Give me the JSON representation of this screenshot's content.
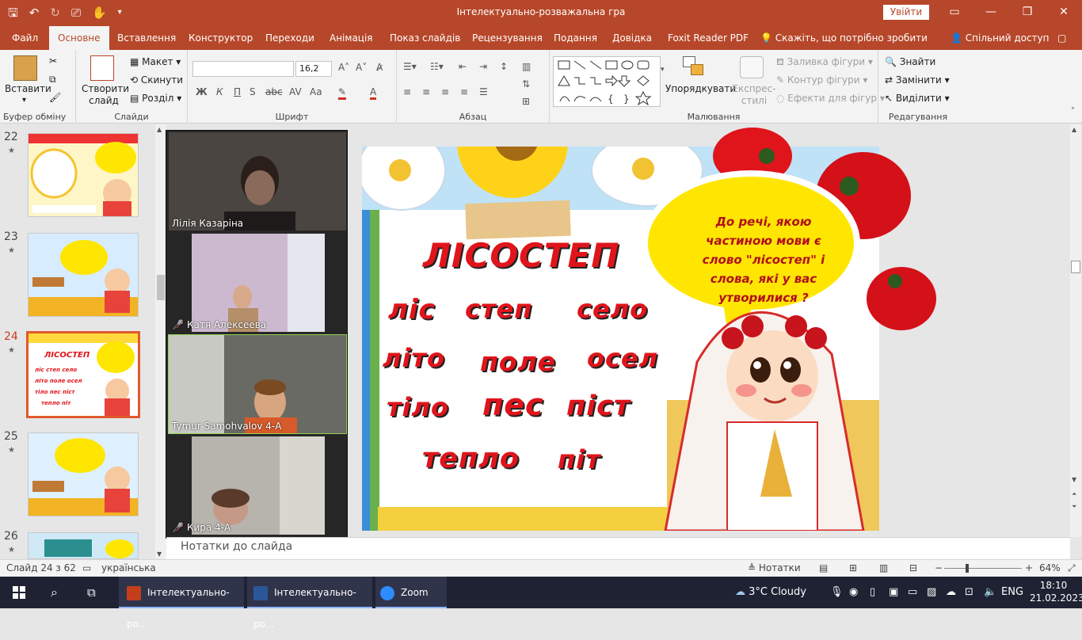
{
  "titlebar": {
    "doc_title": "Інтелектуально-розважальна гра",
    "sign_in": "Увійти",
    "qat": [
      "save-icon",
      "undo-icon",
      "redo-icon",
      "present-icon",
      "touch-icon",
      "customize-icon"
    ],
    "win": {
      "minimize": "—",
      "restore": "❐",
      "close": "✕"
    }
  },
  "tabs": [
    "Файл",
    "Основне",
    "Вставлення",
    "Конструктор",
    "Переходи",
    "Анімація",
    "Показ слайдів",
    "Рецензування",
    "Подання",
    "Довідка",
    "Foxit Reader PDF",
    "Скажіть, що потрібно зробити",
    "Спільний доступ"
  ],
  "ribbon": {
    "clipboard": {
      "paste": "Вставити",
      "label": "Буфер обміну"
    },
    "slides": {
      "new_slide": "Створити слайд",
      "layout": "Макет",
      "reset": "Скинути",
      "section": "Розділ",
      "label": "Слайди"
    },
    "font": {
      "font_name": "",
      "font_size": "16,2",
      "label": "Шрифт",
      "bold": "Ж",
      "italic": "К",
      "underline": "П",
      "strike": "abc",
      "spacing": "AV",
      "case": "Aa",
      "color": "A"
    },
    "paragraph": {
      "label": "Абзац"
    },
    "drawing": {
      "arrange": "Упорядкувати",
      "styles": "Експрес-стилі",
      "fill": "Заливка фігури",
      "outline": "Контур фігури",
      "effects": "Ефекти для фігур",
      "label": "Малювання"
    },
    "editing": {
      "find": "Знайти",
      "replace": "Замінити",
      "select": "Виділити",
      "label": "Редагування"
    }
  },
  "thumbnails": [
    {
      "num": "22",
      "star": "★",
      "selected": false
    },
    {
      "num": "23",
      "star": "★",
      "selected": false
    },
    {
      "num": "24",
      "star": "★",
      "selected": true
    },
    {
      "num": "25",
      "star": "★",
      "selected": false
    },
    {
      "num": "26",
      "star": "★",
      "selected": false
    }
  ],
  "zoom": {
    "participants": [
      {
        "name": "Лілія Казаріна",
        "muted": false
      },
      {
        "name": "Катя Алексеева",
        "muted": true
      },
      {
        "name": "Tymur Samohvalov 4-А",
        "muted": false
      },
      {
        "name": "Кира 4-А",
        "muted": true
      }
    ]
  },
  "slide": {
    "title": "ЛІСОСТЕП",
    "words": [
      "ліс",
      "степ",
      "село",
      "літо",
      "поле",
      "осел",
      "тіло",
      "пес",
      "піст",
      "тепло",
      "піт"
    ],
    "bubble_lines": [
      "До речі, якою",
      "частиною мови є",
      "слово \"лісостеп\"  і",
      "слова, які у вас",
      "утворилися ?"
    ]
  },
  "notes_placeholder": "Нотатки до слайда",
  "status": {
    "slide_info": "Слайд 24 з 62",
    "language": "українська",
    "notes_btn": "Нотатки",
    "zoom_level": "64%"
  },
  "taskbar": {
    "apps": [
      "Інтелектуально-ро...",
      "Інтелектуально-ро...",
      "Zoom"
    ],
    "weather": "3°C  Cloudy",
    "lang": "ENG",
    "time": "18:10",
    "date": "21.02.2023"
  },
  "colors": {
    "accent": "#b7472a",
    "slide_red": "#e0141b",
    "bubble_yellow": "#ffe600"
  }
}
